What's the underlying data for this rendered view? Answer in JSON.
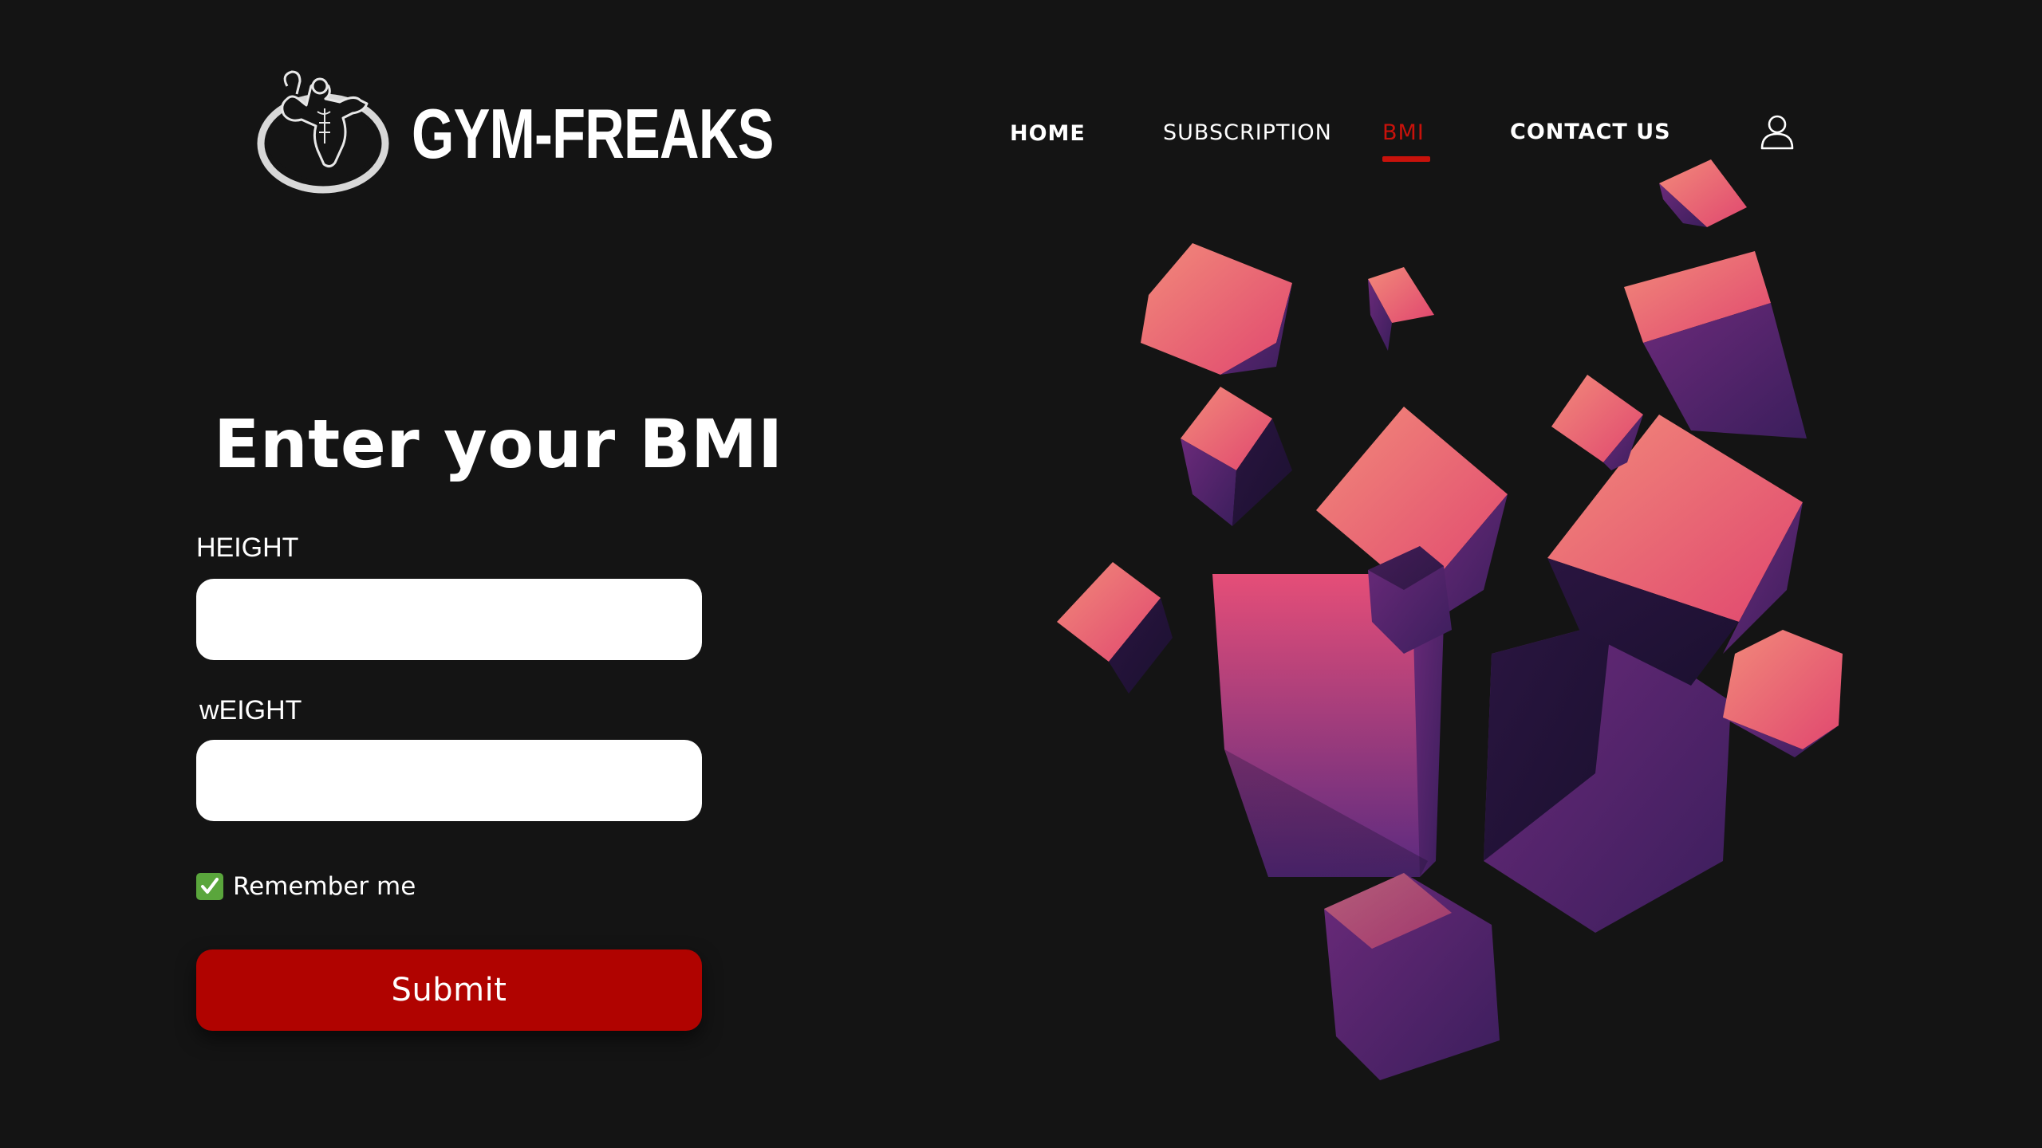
{
  "brand": {
    "name": "GYM-FREAKS",
    "logo_icon": "bodybuilder-emblem-icon"
  },
  "nav": {
    "items": [
      {
        "label": "HOME",
        "active": false
      },
      {
        "label": "SUBSCRIPTION",
        "active": false
      },
      {
        "label": "BMI",
        "active": true
      },
      {
        "label": "CONTACT US",
        "active": false
      }
    ],
    "user_icon": "user-icon"
  },
  "form": {
    "title": "Enter your BMI",
    "height_label": "HEIGHT",
    "height_value": "",
    "weight_label": "wEIGHT",
    "weight_value": "",
    "remember_label": "Remember me",
    "remember_checked": true,
    "submit_label": "Submit"
  },
  "colors": {
    "background": "#141414",
    "accent": "#b00300",
    "active_nav": "#c8120b",
    "checkbox": "#5aa63c"
  },
  "hero_image": "floating-cubes-illustration"
}
